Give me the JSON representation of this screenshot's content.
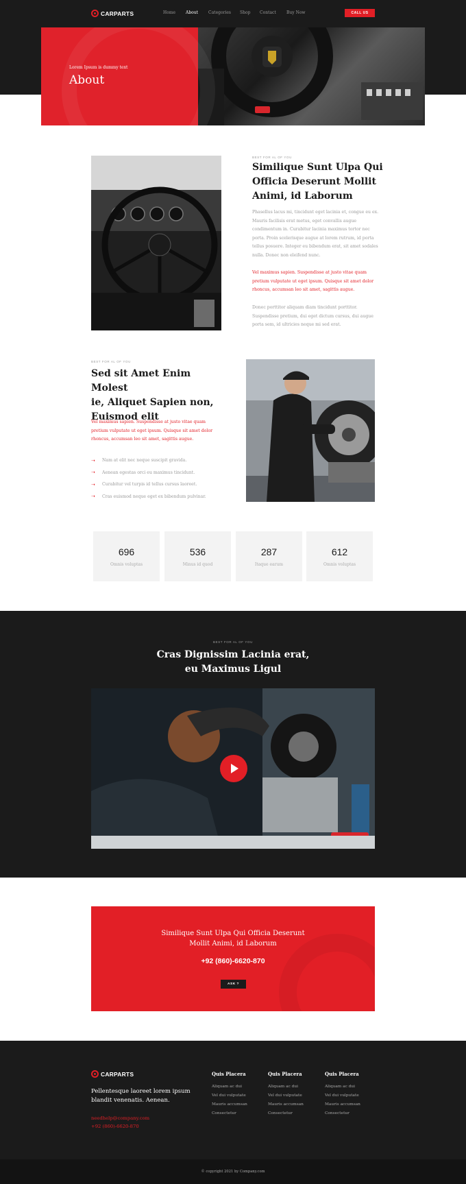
{
  "brand": {
    "name": "CARPARTS"
  },
  "nav": {
    "items": [
      "Home",
      "About",
      "Categories",
      "Shop",
      "Contact",
      "Buy Now"
    ],
    "active": "About",
    "cta": "CALL US"
  },
  "hero": {
    "subtitle": "Lorem Ipsum is dummy text",
    "title": "About"
  },
  "about1": {
    "eyebrow": "BEST FOR AL OF YOU",
    "title_lines": [
      "Similique Sunt Ulpa Qui",
      "Officia Deserunt Mollit",
      "Animi, id Laborum"
    ],
    "para1_lines": [
      "Phasellus lacus mi, tincidunt eget lacinia et, congue eu ex.",
      "Mauris facilisis erat metus, eget convallis augue",
      "condimentum in. Curabitur lacinia maximus tortor nec",
      "porta. Proin scelerisque augue at lorem rutrum, id porta",
      "tellus posuere. Integer eu bibendum erat, sit amet sodales",
      "nulla. Donec non eleifend nunc."
    ],
    "red_lines": [
      "Vel maximus sapien. Suspendisse at justo vitae quam",
      "pretium vulputate ut eget ipsum. Quisque sit amet dolor",
      "rhoncus, accumsan leo sit amet, sagittis augue."
    ],
    "para2_lines": [
      "Donec porttitor aliquam diam tincidunt porttitor.",
      "Suspendisse pretium, dui eget dictum cursus, dui augue",
      "porta sem, id ultricies neque mi sed erat."
    ]
  },
  "about2": {
    "eyebrow": "BEST FOR AL OF YOU",
    "title_lines": [
      "Sed sit Amet Enim Molest",
      "ie, Aliquet Sapien non,",
      "Euismod elit"
    ],
    "red_lines": [
      "Vel maximus sapien. Suspendisse at justo vitae quam",
      "pretium vulputate ut eget ipsum. Quisque sit amet dolor",
      "rhoncus, accumsan leo sit amet, sagittis augue."
    ],
    "bullets": [
      "Nam at elit nec neque suscipit gravida.",
      "Aenean egestas orci eu maximus tincidunt.",
      "Curabitur vel turpis id tellus cursus laoreet.",
      "Cras euismod neque eget ex bibendum pulvinar."
    ]
  },
  "stats": [
    {
      "value": "696",
      "label": "Omnis voluptas"
    },
    {
      "value": "536",
      "label": "Minus id quod"
    },
    {
      "value": "287",
      "label": "Itaque earum"
    },
    {
      "value": "612",
      "label": "Omnis voluptas"
    }
  ],
  "video": {
    "eyebrow": "BEST FOR AL OF YOU",
    "title_lines": [
      "Cras Dignissim Lacinia erat,",
      "eu Maximus Ligul"
    ]
  },
  "cta": {
    "title_lines": [
      "Similique Sunt Ulpa Qui Officia Deserunt",
      "Mollit Animi, id Laborum"
    ],
    "phone": "+92 (860)-6620-870",
    "button": "ASK ?"
  },
  "footer": {
    "brand": "CARPARTS",
    "description_lines": [
      "Pellentesque laoreet lorem ipsum",
      "blandit venenatis. Aenean."
    ],
    "email": "needhelp@company.com",
    "phone": "+92 (860)-6620-870",
    "columns": [
      {
        "heading": "Quis Placera",
        "links": [
          "Aliquam ac dui",
          "Vel dui vulputate",
          "Mauris accumsan",
          "Consectetur"
        ]
      },
      {
        "heading": "Quis Placera",
        "links": [
          "Aliquam ac dui",
          "Vel dui vulputate",
          "Mauris accumsan",
          "Consectetur"
        ]
      },
      {
        "heading": "Quis Placera",
        "links": [
          "Aliquam ac dui",
          "Vel dui vulputate",
          "Mauris accumsan",
          "Consectetur"
        ]
      }
    ],
    "copyright": "© copyright 2021 by Company.com"
  },
  "colors": {
    "accent": "#e21f26",
    "dark": "#1b1b1b",
    "stat_bg": "#f3f3f3"
  },
  "icons": {
    "logo": "steering-wheel-icon",
    "bullet": "arrow-right-icon",
    "play": "play-icon"
  }
}
